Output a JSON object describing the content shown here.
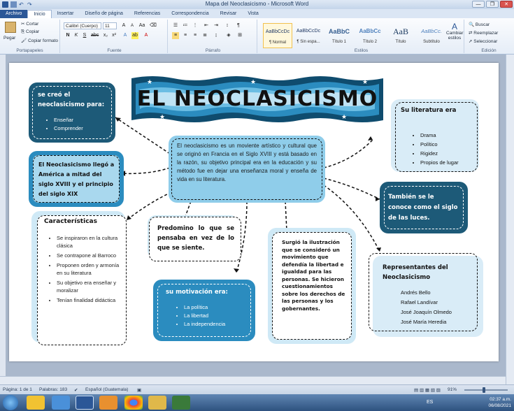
{
  "window": {
    "title": "Mapa del Neoclasicismo - Microsoft Word",
    "min_label": "—",
    "max_label": "❐",
    "close_label": "✕"
  },
  "tabs": [
    "Archivo",
    "Inicio",
    "Insertar",
    "Diseño de página",
    "Referencias",
    "Correspondencia",
    "Revisar",
    "Vista"
  ],
  "ribbon": {
    "clipboard": {
      "paste": "Pegar",
      "cut": "Cortar",
      "copy": "Copiar",
      "format_painter": "Copiar formato",
      "label": "Portapapeles"
    },
    "font": {
      "name": "Calibri (Cuerpo)",
      "size": "11",
      "label": "Fuente"
    },
    "paragraph": {
      "label": "Párrafo"
    },
    "styles": {
      "label": "Estilos",
      "items": [
        {
          "sample": "AaBbCcDc",
          "name": "¶ Normal"
        },
        {
          "sample": "AaBbCcDc",
          "name": "¶ Sin espa..."
        },
        {
          "sample": "AaBbC",
          "name": "Título 1"
        },
        {
          "sample": "AaBbCc",
          "name": "Título 2"
        },
        {
          "sample": "AaB",
          "name": "Título"
        },
        {
          "sample": "AaBbCc.",
          "name": "Subtítulo"
        }
      ],
      "change": "Cambiar estilos"
    },
    "editing": {
      "find": "Buscar",
      "replace": "Reemplazar",
      "select": "Seleccionar",
      "label": "Edición"
    }
  },
  "doc": {
    "title": "EL NEOCLASICISMO",
    "center": "El neoclasicismo es un moviente artístico y cultural que se originó en Francia en el Siglo XVIII y está basado en la razón, su objetivo principal era en la educación y su método fue en dejar una enseñanza moral y enseña de vida en su literatura.",
    "created_for": {
      "heading": "se creó el neoclasicismo para:",
      "items": [
        "Enseñar",
        "Comprender"
      ]
    },
    "arrived": "El Neoclasicismo llegó a América a mitad del siglo XVIII y el principio del siglo XIX",
    "features": {
      "heading": "Características",
      "items": [
        "Se inspiraron en la cultura clásica",
        "Se contrapone al Barroco",
        "Proponen orden y armonía en su literatura",
        "Su objetivo era enseñar y moralizar",
        "Tenían finalidad didáctica"
      ]
    },
    "reason": "Predomino lo que se pensaba en vez de lo que se siente.",
    "motivation": {
      "heading": "su motivación era:",
      "items": [
        "La política",
        "La libertad",
        "La independencia"
      ]
    },
    "illustration": "Surgió la ilustración que se consideró un movimiento que defendía la libertad e igualdad para las personas. Se hicieron cuestionamientos sobre los derechos de las personas y los gobernantes.",
    "literature": {
      "heading": "Su literatura era",
      "items": [
        "Drama",
        "Político",
        "Rigidez",
        "Propios de lugar"
      ]
    },
    "lights": "También se le conoce como el siglo de las luces.",
    "representatives": {
      "heading": "Representantes del Neoclasicismo",
      "items": [
        "Andrés Bello",
        "Rafael Landívar",
        "José Joaquín Olmedo",
        "José María Heredia"
      ]
    }
  },
  "status": {
    "page": "Página: 1 de 1",
    "words": "Palabras: 183",
    "language": "Español (Guatemala)",
    "zoom": "91%",
    "zoom_level": 91
  },
  "taskbar": {
    "lang": "ES",
    "time": "02:37 a.m.",
    "date": "06/08/2021"
  },
  "colors": {
    "dark_teal": "#1d5a78",
    "mid_blue": "#2b8cbf",
    "light_blue": "#a9d8ee",
    "pale_blue": "#d9ecf7",
    "word_blue": "#2b5797"
  }
}
